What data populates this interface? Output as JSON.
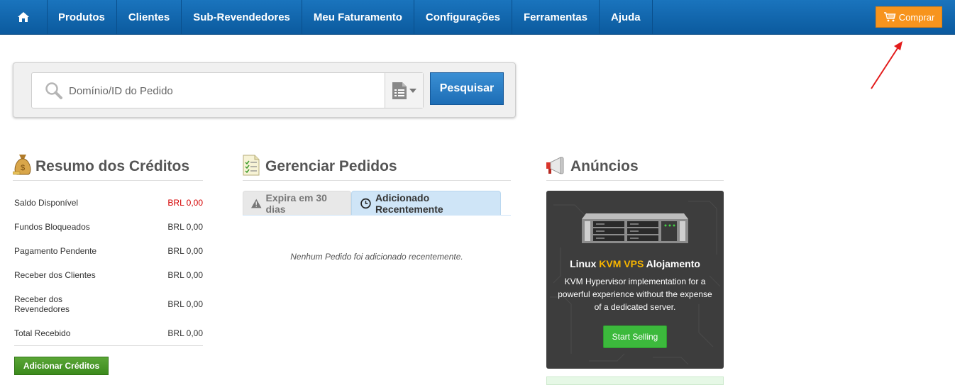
{
  "nav": {
    "home_icon": "home-icon",
    "items": [
      "Produtos",
      "Clientes",
      "Sub-Revendedores",
      "Meu Faturamento",
      "Configurações",
      "Ferramentas",
      "Ajuda"
    ],
    "buy_label": "Comprar",
    "buy_icon": "cart-icon"
  },
  "search": {
    "placeholder": "Domínio/ID do Pedido",
    "button_label": "Pesquisar"
  },
  "credits": {
    "title": "Resumo dos Créditos",
    "rows": [
      {
        "label": "Saldo Disponível",
        "value": "BRL 0,00"
      },
      {
        "label": "Fundos Bloqueados",
        "value": "BRL 0,00"
      },
      {
        "label": "Pagamento Pendente",
        "value": "BRL 0,00"
      },
      {
        "label": "Receber dos Clientes",
        "value": "BRL 0,00"
      },
      {
        "label": "Receber dos Revendedores",
        "value": "BRL 0,00"
      },
      {
        "label": "Total Recebido",
        "value": "BRL 0,00"
      }
    ],
    "add_button": "Adicionar Créditos",
    "negative_color": "#d40000"
  },
  "orders": {
    "title": "Gerenciar Pedidos",
    "tabs": [
      "Expira em 30 dias",
      "Adicionado Recentemente"
    ],
    "empty_message": "Nenhum Pedido foi adicionado recentemente."
  },
  "ads": {
    "title": "Anúncios",
    "card_title_pre": "Linux ",
    "card_title_highlight": "KVM VPS",
    "card_title_post": " Alojamento",
    "card_desc": "KVM Hypervisor implementation for a powerful experience without the expense of a dedicated server.",
    "card_button": "Start Selling"
  },
  "colors": {
    "nav_bg": "#0b5a9e",
    "buy_button": "#f7941d",
    "search_button": "#1d6db5",
    "add_credits_button": "#3b8a1c",
    "highlight": "#f7b500",
    "ad_button": "#3cb93c"
  }
}
